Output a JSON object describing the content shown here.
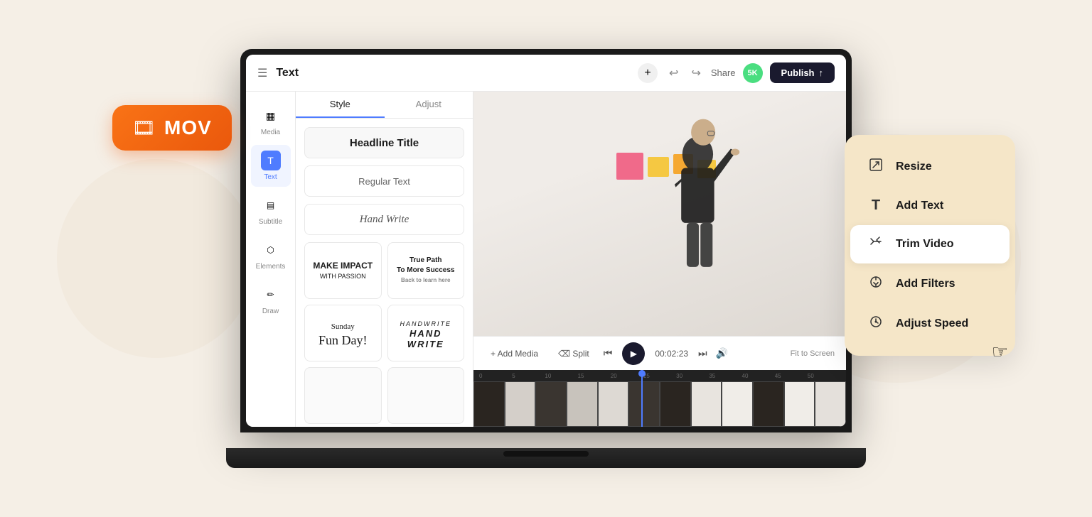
{
  "page": {
    "title": "Text",
    "background_color": "#f5efe6"
  },
  "mov_badge": {
    "label": "MOV",
    "icon": "🎞"
  },
  "top_bar": {
    "menu_icon": "☰",
    "title": "Text",
    "add_label": "+",
    "undo_icon": "↩",
    "redo_icon": "↪",
    "share_label": "Share",
    "avatar_label": "5K",
    "publish_label": "Publish",
    "publish_icon": "↑"
  },
  "sidebar": {
    "items": [
      {
        "id": "media",
        "label": "Media",
        "icon": "□"
      },
      {
        "id": "text",
        "label": "Text",
        "icon": "T",
        "active": true
      },
      {
        "id": "subtitle",
        "label": "Subtitle",
        "icon": "▤"
      },
      {
        "id": "elements",
        "label": "Elements",
        "icon": "⬡"
      },
      {
        "id": "draw",
        "label": "Draw",
        "icon": "✏"
      }
    ]
  },
  "text_panel": {
    "tabs": [
      {
        "id": "style",
        "label": "Style",
        "active": true
      },
      {
        "id": "adjust",
        "label": "Adjust",
        "active": false
      }
    ],
    "styles": [
      {
        "id": "headline",
        "label": "Headline Title",
        "type": "headline"
      },
      {
        "id": "regular",
        "label": "Regular Text",
        "type": "regular"
      },
      {
        "id": "handwrite",
        "label": "Hand Write",
        "type": "handwrite"
      }
    ],
    "templates": [
      {
        "id": "bold",
        "line1": "MAKE IMPACT",
        "line2": "With Passion",
        "type": "bold"
      },
      {
        "id": "serif",
        "line1": "True Path",
        "line2": "To More Success",
        "line3": "Back to learn here",
        "type": "serif"
      },
      {
        "id": "script",
        "line1": "Sunday",
        "line2": "Fun Day!",
        "type": "script"
      },
      {
        "id": "handwrite2",
        "line1": "HandWrite",
        "line2": "HAND WRITE",
        "type": "handwrite"
      },
      {
        "id": "empty1",
        "type": "empty"
      },
      {
        "id": "empty2",
        "type": "empty"
      }
    ]
  },
  "timeline": {
    "add_media_label": "+ Add Media",
    "split_label": "⌫ Split",
    "time_display": "00:02:23",
    "ruler_marks": [
      "0",
      "5",
      "10",
      "15",
      "20",
      "25",
      "30",
      "35",
      "40",
      "45",
      "50"
    ],
    "fit_screen_label": "Fit to Screen"
  },
  "context_menu": {
    "items": [
      {
        "id": "resize",
        "label": "Resize",
        "icon": "resize"
      },
      {
        "id": "add-text",
        "label": "Add Text",
        "icon": "text"
      },
      {
        "id": "trim-video",
        "label": "Trim Video",
        "icon": "trim",
        "active": true
      },
      {
        "id": "add-filters",
        "label": "Add Filters",
        "icon": "filter"
      },
      {
        "id": "adjust-speed",
        "label": "Adjust Speed",
        "icon": "speed"
      }
    ]
  }
}
